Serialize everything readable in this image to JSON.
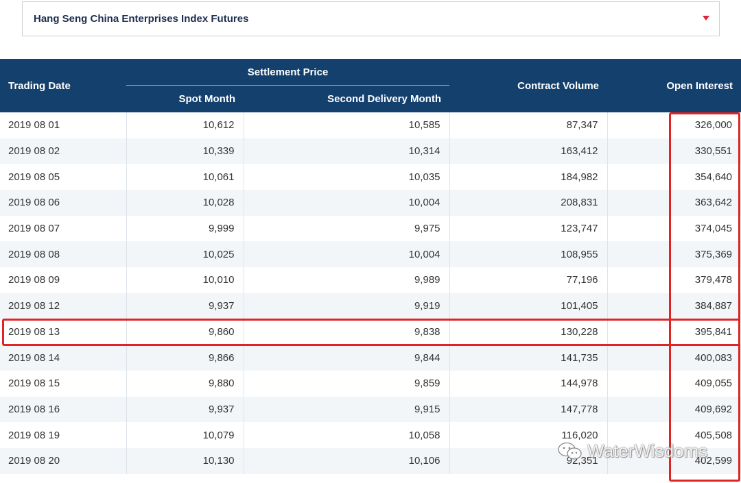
{
  "selector": {
    "label": "Hang Seng China Enterprises Index Futures"
  },
  "colors": {
    "header_bg": "#14406d",
    "highlight": "#e02424",
    "caret": "#e0243a"
  },
  "table": {
    "headers": {
      "trading_date": "Trading Date",
      "settlement_price": "Settlement Price",
      "spot_month": "Spot Month",
      "second_delivery_month": "Second Delivery Month",
      "contract_volume": "Contract Volume",
      "open_interest": "Open Interest"
    },
    "rows": [
      [
        "2019 08 01",
        "10,612",
        "10,585",
        "87,347",
        "326,000"
      ],
      [
        "2019 08 02",
        "10,339",
        "10,314",
        "163,412",
        "330,551"
      ],
      [
        "2019 08 05",
        "10,061",
        "10,035",
        "184,982",
        "354,640"
      ],
      [
        "2019 08 06",
        "10,028",
        "10,004",
        "208,831",
        "363,642"
      ],
      [
        "2019 08 07",
        "9,999",
        "9,975",
        "123,747",
        "374,045"
      ],
      [
        "2019 08 08",
        "10,025",
        "10,004",
        "108,955",
        "375,369"
      ],
      [
        "2019 08 09",
        "10,010",
        "9,989",
        "77,196",
        "379,478"
      ],
      [
        "2019 08 12",
        "9,937",
        "9,919",
        "101,405",
        "384,887"
      ],
      [
        "2019 08 13",
        "9,860",
        "9,838",
        "130,228",
        "395,841"
      ],
      [
        "2019 08 14",
        "9,866",
        "9,844",
        "141,735",
        "400,083"
      ],
      [
        "2019 08 15",
        "9,880",
        "9,859",
        "144,978",
        "409,055"
      ],
      [
        "2019 08 16",
        "9,937",
        "9,915",
        "147,778",
        "409,692"
      ],
      [
        "2019 08 19",
        "10,079",
        "10,058",
        "116,020",
        "405,508"
      ],
      [
        "2019 08 20",
        "10,130",
        "10,106",
        "92,351",
        "402,599"
      ]
    ]
  },
  "watermark": {
    "text": "WaterWisdoms",
    "icon": "wechat-icon"
  }
}
